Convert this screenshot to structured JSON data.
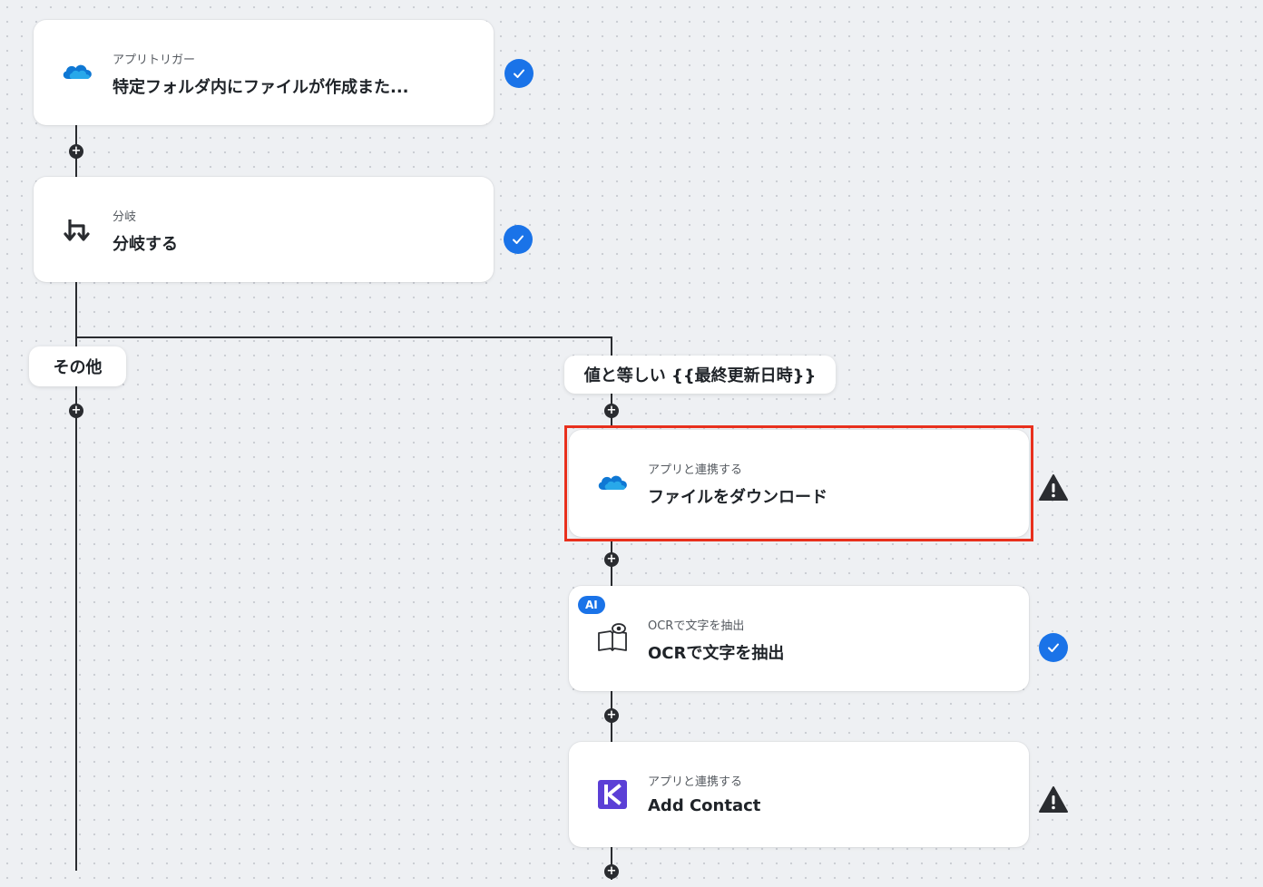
{
  "colors": {
    "accent": "#1a73e8",
    "highlight": "#e8301d",
    "connector": "#2a2c30",
    "krayin_purple": "#5b3fd6",
    "onedrive_blue": "#0f78d4"
  },
  "connector_add_icon": "+",
  "steps": [
    {
      "subtitle": "アプリトリガー",
      "title": "特定フォルダ内にファイルが作成また...",
      "icon": "onedrive-cloud-icon",
      "status": "check-icon"
    },
    {
      "subtitle": "分岐",
      "title": "分岐する",
      "icon": "branch-icon",
      "status": "check-icon"
    }
  ],
  "branches": {
    "left": {
      "label": "その他"
    },
    "right": {
      "label": "値と等しい {{最終更新日時}}"
    }
  },
  "branch_steps": [
    {
      "subtitle": "アプリと連携する",
      "title": "ファイルをダウンロード",
      "icon": "onedrive-cloud-icon",
      "status": "warning-icon",
      "highlighted": true
    },
    {
      "subtitle": "OCRで文字を抽出",
      "title": "OCRで文字を抽出",
      "icon": "ocr-book-eye-icon",
      "badge": "AI",
      "status": "check-icon"
    },
    {
      "subtitle": "アプリと連携する",
      "title": "Add Contact",
      "icon": "krayin-k-icon",
      "status": "warning-icon"
    }
  ]
}
